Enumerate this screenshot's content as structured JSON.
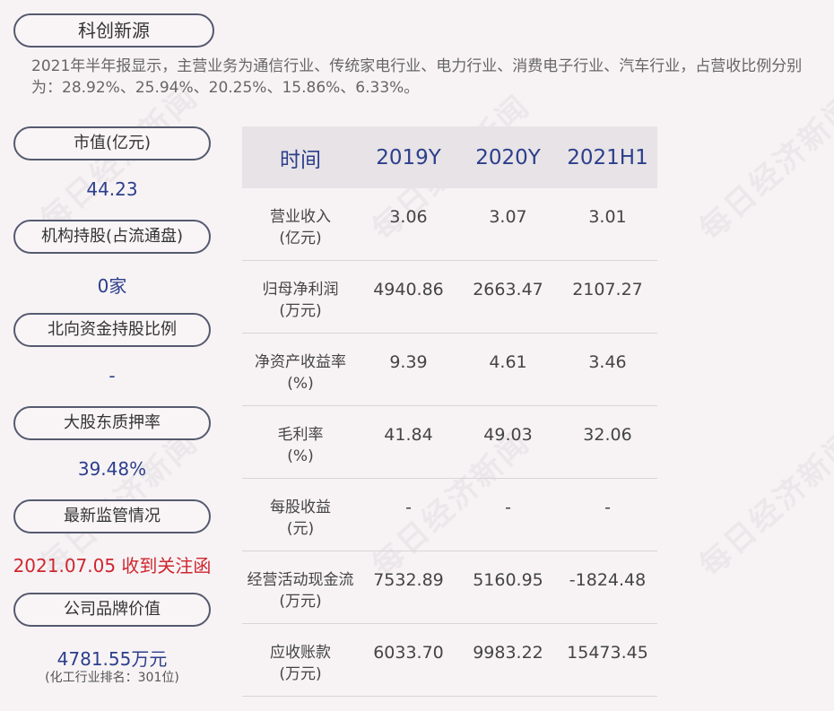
{
  "title": "科创新源",
  "intro": "2021年半年报显示，主营业务为通信行业、传统家电行业、电力行业、消费电子行业、汽车行业，占营收比例分别为：28.92%、25.94%、20.25%、15.86%、6.33%。",
  "sidebar": [
    {
      "label": "市值(亿元)",
      "value": "44.23"
    },
    {
      "label": "机构持股(占流通盘)",
      "value": "0家"
    },
    {
      "label": "北向资金持股比例",
      "value": "-"
    },
    {
      "label": "大股东质押率",
      "value": "39.48%"
    },
    {
      "label": "最新监管情况",
      "value": "2021.07.05 收到关注函"
    },
    {
      "label": "公司品牌价值",
      "value": "4781.55万元",
      "sub": "(化工行业排名：301位)"
    }
  ],
  "table": {
    "headers": [
      "时间",
      "2019Y",
      "2020Y",
      "2021H1"
    ],
    "rows": [
      {
        "label": [
          "营业收入",
          "(亿元)"
        ],
        "values": [
          "3.06",
          "3.07",
          "3.01"
        ]
      },
      {
        "label": [
          "归母净利润",
          "(万元)"
        ],
        "values": [
          "4940.86",
          "2663.47",
          "2107.27"
        ]
      },
      {
        "label": [
          "净资产收益率",
          "(%)"
        ],
        "values": [
          "9.39",
          "4.61",
          "3.46"
        ]
      },
      {
        "label": [
          "毛利率",
          "(%)"
        ],
        "values": [
          "41.84",
          "49.03",
          "32.06"
        ]
      },
      {
        "label": [
          "每股收益",
          "(元)"
        ],
        "values": [
          "-",
          "-",
          "-"
        ]
      },
      {
        "label": [
          "经营活动现金流",
          "(万元)"
        ],
        "values": [
          "7532.89",
          "5160.95",
          "-1824.48"
        ]
      },
      {
        "label": [
          "应收账款",
          "(万元)"
        ],
        "values": [
          "6033.70",
          "9983.22",
          "15473.45"
        ]
      }
    ]
  },
  "watermark": "每日经济新闻",
  "colors": {
    "background": "#f7f3f5",
    "accent": "#2c3e8c",
    "alert": "#d0262e"
  }
}
